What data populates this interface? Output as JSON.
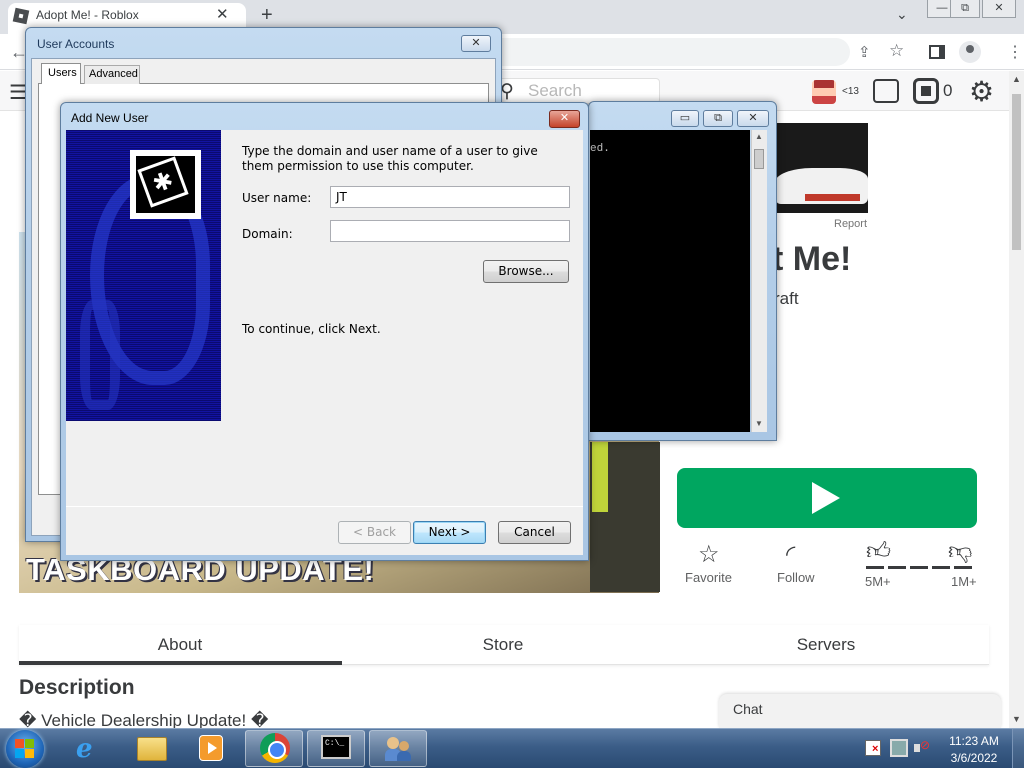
{
  "browser": {
    "tab_title": "Adopt Me! - Roblox",
    "tab_close": "✕",
    "new_tab": "+",
    "tab_search": "⌄",
    "window_controls": {
      "minimize": "—",
      "restore": "⧉",
      "close": "✕"
    },
    "back": "←",
    "share": "⇪",
    "star": "☆",
    "menu": "⋮"
  },
  "roblox": {
    "search_placeholder": "Search",
    "age_badge": "<13",
    "robux_count": "0",
    "ad_report": "Report",
    "game_title_visible": "t Me!",
    "creator_visible": "raft",
    "hero_banner": "TASKBOARD UPDATE!",
    "actions": {
      "favorite": "Favorite",
      "follow": "Follow",
      "upvotes": "5M+",
      "downvotes": "1M+"
    },
    "tabs": [
      "About",
      "Store",
      "Servers"
    ],
    "description_heading": "Description",
    "description_text": "� Vehicle Dealership Update! �",
    "chat": "Chat"
  },
  "user_accounts": {
    "title": "User Accounts",
    "tabs": [
      "Users",
      "Advanced"
    ]
  },
  "cmd": {
    "text": "ed."
  },
  "add_new_user": {
    "title": "Add New User",
    "instruction": "Type the domain and user name of a user to give them permission to use this computer.",
    "username_label": "User name:",
    "username_value": "JT",
    "domain_label": "Domain:",
    "domain_value": "",
    "browse_button": "Browse...",
    "continue_text": "To continue, click Next.",
    "back_button": "< Back",
    "next_button": "Next >",
    "cancel_button": "Cancel"
  },
  "taskbar": {
    "time": "11:23 AM",
    "date": "3/6/2022"
  },
  "colors": {
    "play_green": "#00a660",
    "taskbar_blue": "#2a4a72",
    "dialog_frame": "#b5cfe9"
  }
}
